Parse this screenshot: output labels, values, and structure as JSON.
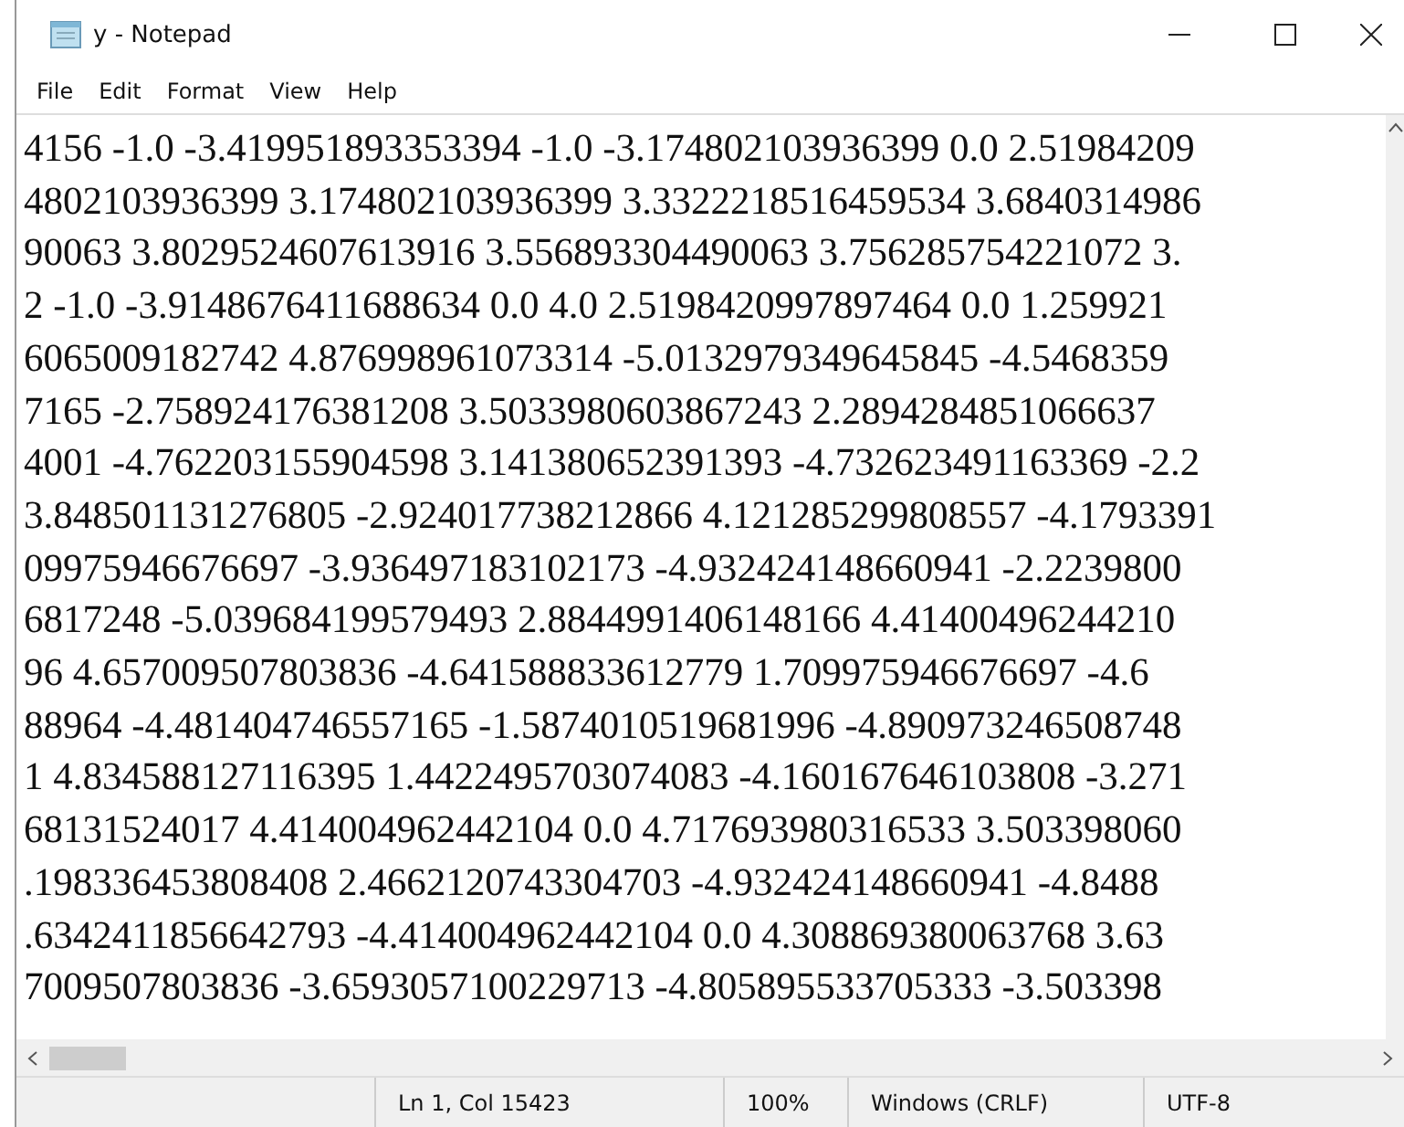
{
  "window": {
    "title": "y - Notepad"
  },
  "menu": [
    "File",
    "Edit",
    "Format",
    "View",
    "Help"
  ],
  "editor": {
    "lines": [
      "4156 -1.0 -3.419951893353394 -1.0 -3.174802103936399 0.0 2.51984209",
      "4802103936399 3.174802103936399 3.3322218516459534 3.6840314986",
      "90063 3.8029524607613916 3.556893304490063 3.756285754221072 3.",
      "2 -1.0 -3.9148676411688634 0.0 4.0 2.5198420997897464 0.0 1.259921",
      "6065009182742 4.876998961073314 -5.0132979349645845 -4.5468359",
      "7165 -2.758924176381208 3.5033980603867243 2.2894284851066637",
      "4001 -4.762203155904598 3.141380652391393 -4.732623491163369 -2.2",
      "3.848501131276805 -2.924017738212866 4.121285299808557 -4.1793391",
      "09975946676697 -3.936497183102173 -4.932424148660941 -2.2239800",
      "6817248 -5.039684199579493 2.8844991406148166 4.41400496244210",
      "96 4.657009507803836 -4.641588833612779 1.709975946676697 -4.6",
      "88964 -4.481404746557165 -1.5874010519681996 -4.890973246508748",
      "1 4.834588127116395 1.4422495703074083 -4.160167646103808 -3.271",
      "68131524017 4.414004962442104 0.0 4.717693980316533 3.503398060",
      ".198336453808408 2.4662120743304703 -4.932424148660941 -4.8488",
      ".6342411856642793 -4.414004962442104 0.0 4.308869380063768 3.63",
      "7009507803836 -3.6593057100229713 -4.805895533705333 -3.503398"
    ]
  },
  "status_bar": [
    "Ln 1, Col 15423",
    "100%",
    "Windows (CRLF)",
    "UTF-8"
  ]
}
